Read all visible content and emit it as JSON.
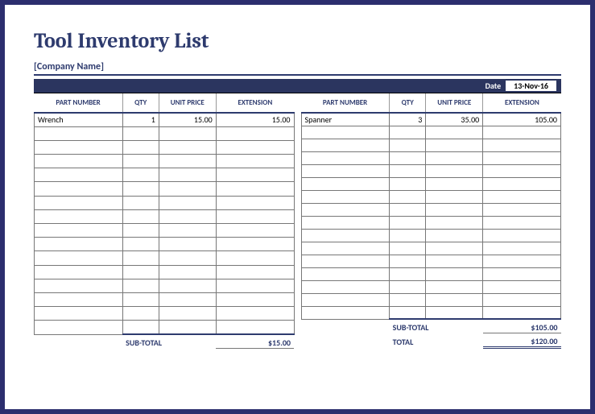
{
  "title": "Tool Inventory List",
  "company_label": "[Company Name]",
  "date": {
    "label": "Date",
    "value": "13-Nov-16"
  },
  "columns": {
    "part": "PART NUMBER",
    "qty": "QTY",
    "price": "UNIT PRICE",
    "ext": "EXTENSION"
  },
  "left": {
    "rows": [
      {
        "part": "Wrench",
        "qty": "1",
        "price": "15.00",
        "ext": "15.00"
      }
    ],
    "subtotal_label": "SUB-TOTAL",
    "subtotal_value": "$15.00"
  },
  "right": {
    "rows": [
      {
        "part": "Spanner",
        "qty": "3",
        "price": "35.00",
        "ext": "105.00"
      }
    ],
    "subtotal_label": "SUB-TOTAL",
    "subtotal_value": "$105.00",
    "total_label": "TOTAL",
    "total_value": "$120.00"
  },
  "blank_rows": 15
}
